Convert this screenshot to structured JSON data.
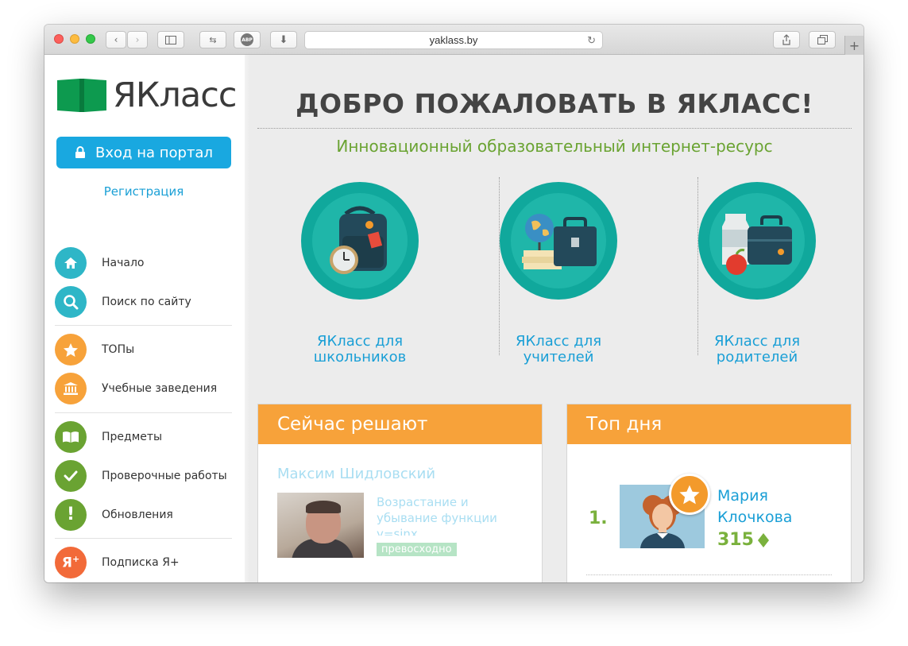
{
  "browser": {
    "url": "yaklass.by"
  },
  "sidebar": {
    "logo_text": "ЯКласс",
    "login_label": "Вход на портал",
    "register_label": "Регистрация",
    "items": [
      {
        "label": "Начало",
        "color": "#2eb6c7",
        "icon": "home-icon"
      },
      {
        "label": "Поиск по сайту",
        "color": "#2eb6c7",
        "icon": "search-icon"
      },
      {
        "label": "ТОПы",
        "color": "#f7a23a",
        "icon": "star-icon"
      },
      {
        "label": "Учебные заведения",
        "color": "#f7a23a",
        "icon": "institution-icon"
      },
      {
        "label": "Предметы",
        "color": "#6aa332",
        "icon": "book-icon"
      },
      {
        "label": "Проверочные работы",
        "color": "#6aa332",
        "icon": "check-icon"
      },
      {
        "label": "Обновления",
        "color": "#6aa332",
        "icon": "exclamation-icon"
      },
      {
        "label": "Подписка Я+",
        "color": "#f26a39",
        "icon": "ya-plus-icon"
      }
    ]
  },
  "main": {
    "welcome_title": "ДОБРО ПОЖАЛОВАТЬ В ЯКЛАСС!",
    "subtitle": "Инновационный образовательный интернет-ресурс",
    "roles": [
      {
        "line1": "ЯКласс для",
        "line2": "школьников",
        "icon": "backpack-icon"
      },
      {
        "line1": "ЯКласс для",
        "line2": "учителей",
        "icon": "briefcase-globe-icon"
      },
      {
        "line1": "ЯКласс для",
        "line2": "родителей",
        "icon": "lunchbox-icon"
      }
    ],
    "solving_now": {
      "title": "Сейчас решают",
      "user_name": "Максим Шидловский",
      "task_title": "Возрастание и убывание функции y=sinx",
      "grade": "превосходно"
    },
    "top_day": {
      "title": "Топ дня",
      "rank": "1.",
      "name_line1": "Мария",
      "name_line2": "Клочкова",
      "score": "315"
    }
  },
  "colors": {
    "accent_blue": "#19a8e0",
    "green": "#6aa332",
    "orange": "#f7a23a",
    "teal": "#10a89c"
  }
}
